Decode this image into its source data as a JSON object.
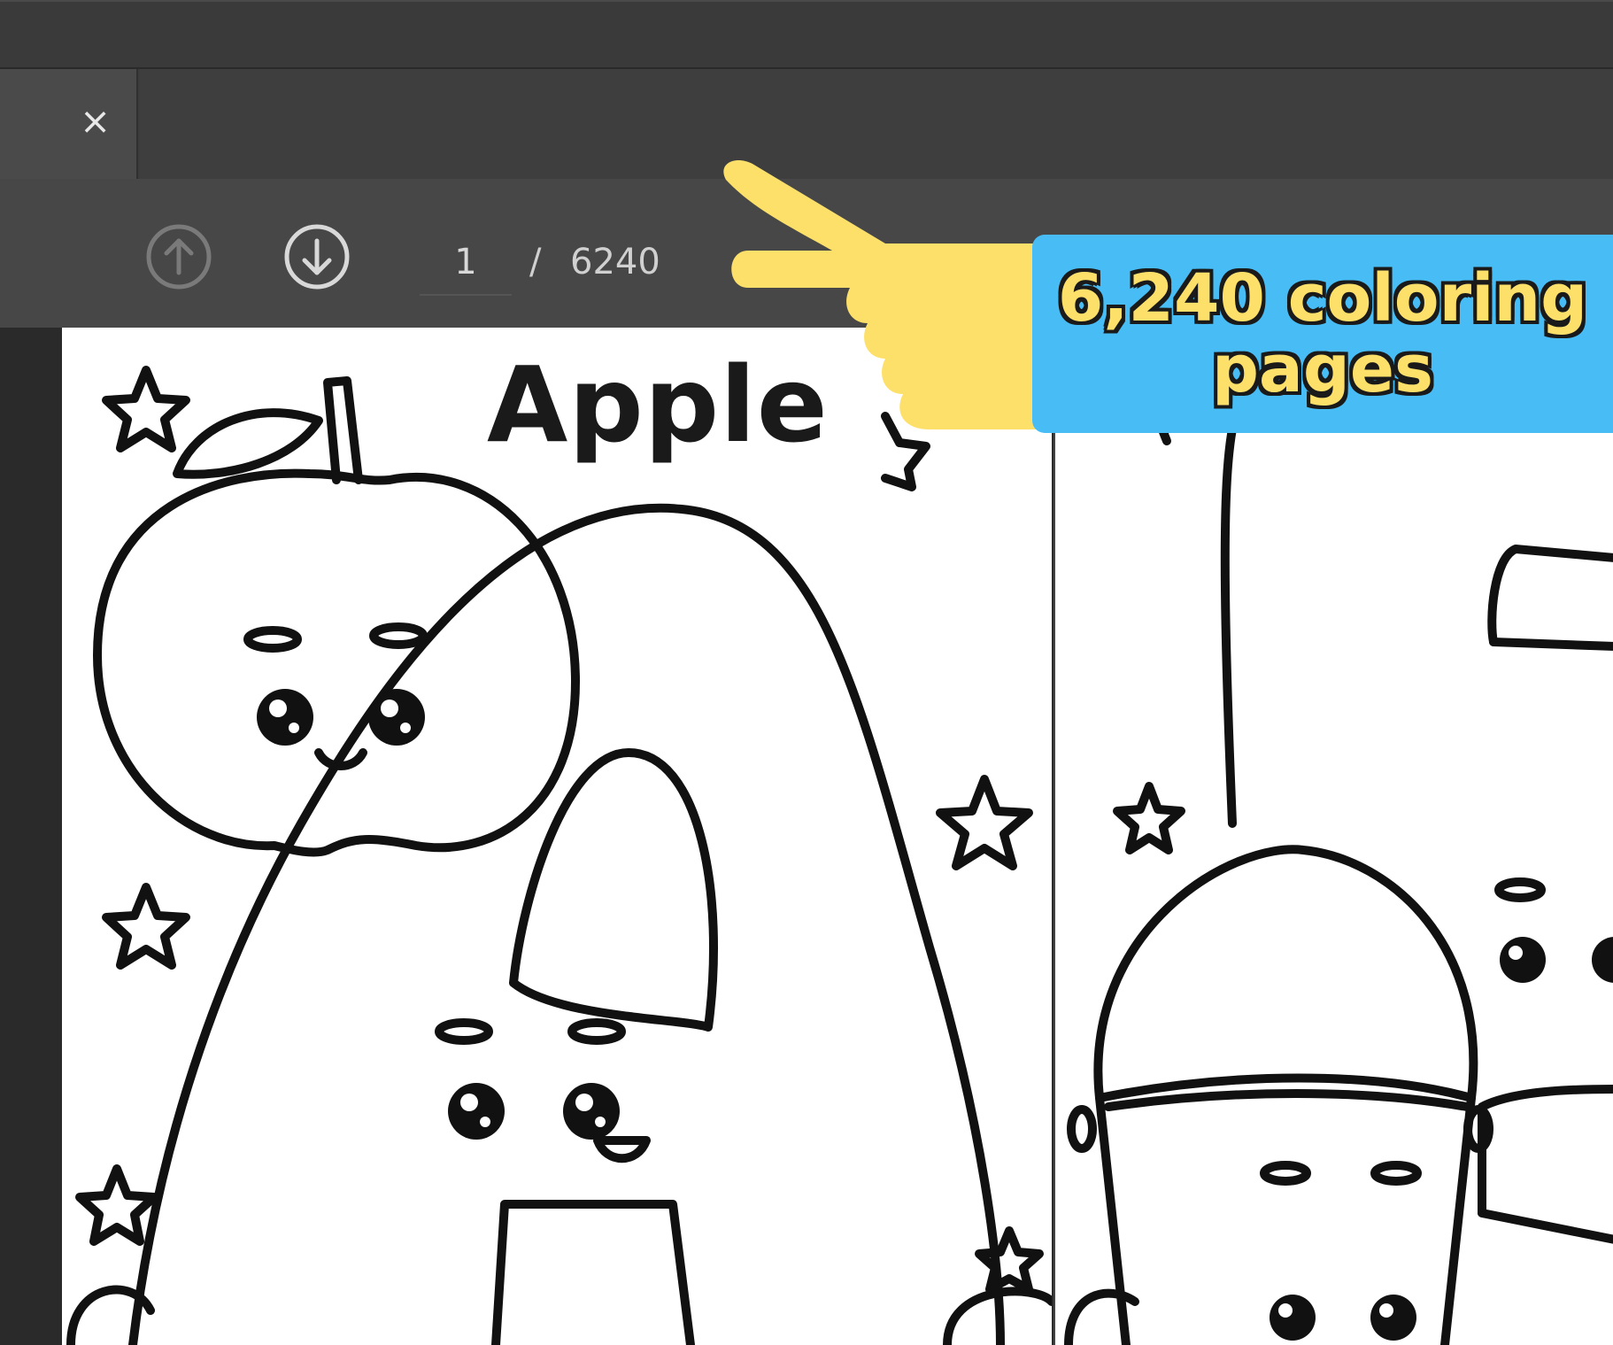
{
  "tab": {
    "close_glyph": "×"
  },
  "toolbar": {
    "prev_icon": "arrow-up-circle-icon",
    "next_icon": "arrow-down-circle-icon",
    "current_page": "1",
    "separator": "/",
    "total_pages": "6240"
  },
  "document": {
    "page1_title": "Apple"
  },
  "callout": {
    "text": "6,240 coloring pages",
    "background": "#48bdf5",
    "text_color": "#fde06a",
    "hand_color": "#fde06a"
  }
}
